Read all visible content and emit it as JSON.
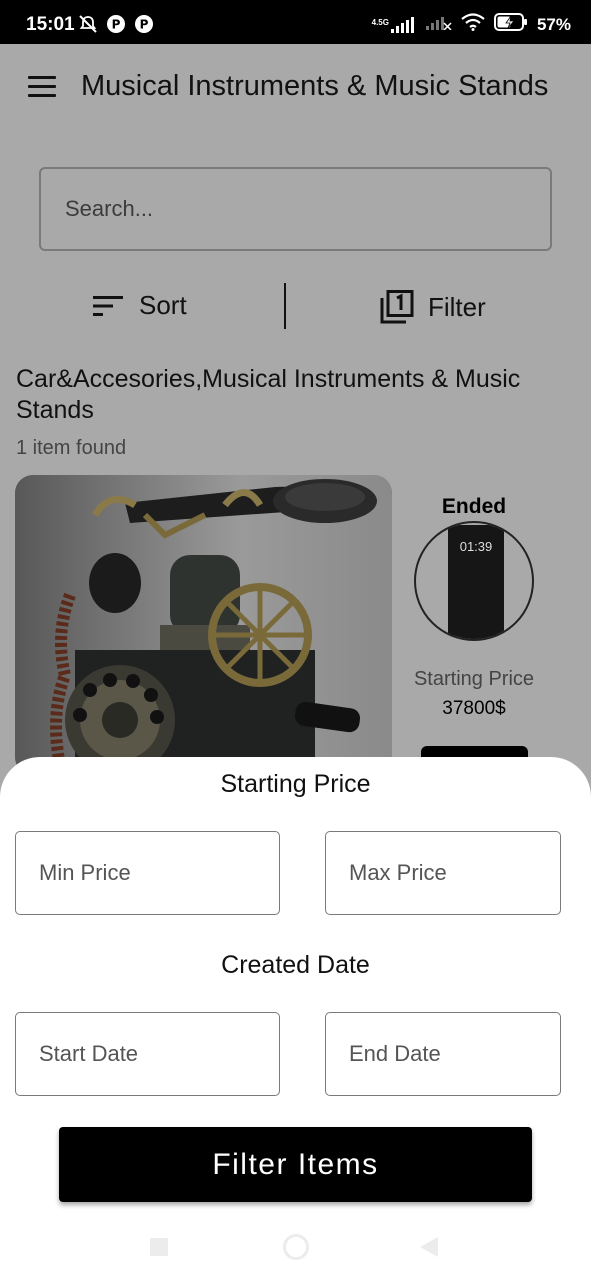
{
  "status_bar": {
    "time": "15:01",
    "network_label": "4.5G",
    "battery": "57%"
  },
  "app_bar": {
    "title": "Musical Instruments & Music Stands",
    "menu_icon": "hamburger-menu-icon"
  },
  "search": {
    "placeholder": "Search..."
  },
  "toolbar": {
    "sort_label": "Sort",
    "filter_label": "Filter"
  },
  "category": {
    "title": "Car&Accesories,Musical Instruments & Music Stands",
    "count": "1 item found"
  },
  "product": {
    "image_alt": "Antique telephone",
    "status": "Ended",
    "timer_time": "01:39",
    "price_label": "Starting Price",
    "price_value": "37800$"
  },
  "filter_sheet": {
    "price_heading": "Starting Price",
    "min_price_placeholder": "Min Price",
    "max_price_placeholder": "Max Price",
    "date_heading": "Created Date",
    "start_date_placeholder": "Start Date",
    "end_date_placeholder": "End Date",
    "submit_label": "Filter Items"
  },
  "colors": {
    "overlay_gray": "#a9a9a9",
    "sheet_white": "#ffffff",
    "primary_black": "#000000"
  }
}
